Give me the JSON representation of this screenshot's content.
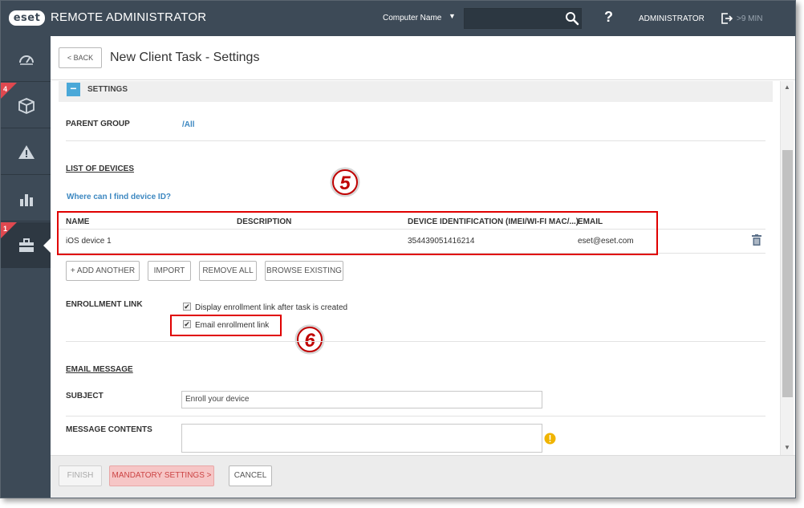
{
  "app": {
    "logo": "eset",
    "title": "REMOTE ADMINISTRATOR"
  },
  "topbar": {
    "computer_name_label": "Computer Name",
    "search_placeholder": "",
    "help": "?",
    "user": "ADMINISTRATOR",
    "session": ">9 MIN"
  },
  "sidebar": {
    "items": [
      {
        "icon": "dashboard-icon",
        "badge": ""
      },
      {
        "icon": "computers-icon",
        "badge": "4"
      },
      {
        "icon": "threats-icon",
        "badge": ""
      },
      {
        "icon": "reports-icon",
        "badge": ""
      },
      {
        "icon": "admin-icon",
        "badge": "1",
        "active": true
      }
    ],
    "pin_icon": "pin-icon"
  },
  "header": {
    "back_label": "< BACK",
    "title": "New Client Task - Settings"
  },
  "settings": {
    "section_label": "SETTINGS",
    "parent_group_label": "PARENT GROUP",
    "parent_group_value": "/All",
    "list_of_devices_label": "LIST OF DEVICES",
    "device_id_help_link": "Where can I find device ID?",
    "table": {
      "columns": [
        "NAME",
        "DESCRIPTION",
        "DEVICE IDENTIFICATION (IMEI/WI-FI MAC/...)",
        "EMAIL"
      ],
      "rows": [
        {
          "name": "iOS device 1",
          "description": "",
          "device_id": "354439051416214",
          "email": "eset@eset.com"
        }
      ]
    },
    "buttons": {
      "add_another": "+ ADD ANOTHER",
      "import": "IMPORT",
      "remove_all": "REMOVE ALL",
      "browse_existing": "BROWSE EXISTING"
    },
    "enrollment_link_label": "ENROLLMENT LINK",
    "display_enrollment_link": {
      "label": "Display enrollment link after task is created",
      "checked": true
    },
    "email_enrollment_link": {
      "label": "Email enrollment link",
      "checked": true
    },
    "email_message_label": "EMAIL MESSAGE",
    "subject_label": "SUBJECT",
    "subject_value": "Enroll your device",
    "message_contents_label": "MESSAGE CONTENTS",
    "message_contents_value": ""
  },
  "callouts": {
    "first": "5",
    "second": "6"
  },
  "footer": {
    "finish": "FINISH",
    "mandatory_settings": "MANDATORY SETTINGS >",
    "cancel": "CANCEL"
  },
  "colors": {
    "topbar": "#3d4a57",
    "accent": "#4aa8d8",
    "link": "#3d88c1",
    "highlight": "#e00000",
    "mandatory_bg": "#f6c6c6"
  }
}
